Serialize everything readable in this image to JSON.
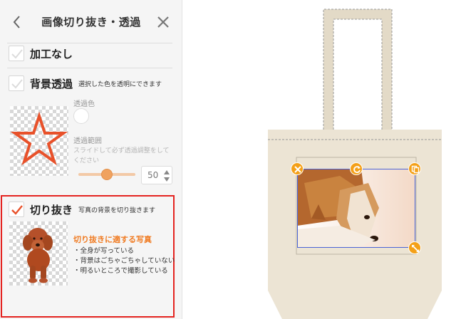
{
  "header": {
    "title": "画像切り抜き・透過",
    "back_icon": "chevron-left-icon",
    "close_icon": "close-icon"
  },
  "options": {
    "no_processing": {
      "label": "加工なし",
      "checked": false
    },
    "background_transparent": {
      "label": "背景透過",
      "description": "選択した色を透明にできます",
      "checked": false,
      "transparent_color_label": "透過色",
      "transparent_range_label": "透過範囲",
      "hint": "スライドして必ず透過調整をしてください",
      "range_value": "50",
      "range_fraction": 0.5
    },
    "cutout": {
      "label": "切り抜き",
      "description": "写真の背景を切り抜きます",
      "checked": true,
      "suitable_title": "切り抜きに適する写真",
      "bullets": [
        "・全身が写っている",
        "・背景はごちゃごちゃしていない",
        "・明るいところで撮影している"
      ]
    }
  },
  "canvas": {
    "product": "tote-bag",
    "handles": [
      "delete-icon",
      "rotate-icon",
      "duplicate-icon",
      "resize-icon"
    ]
  },
  "colors": {
    "accent": "#e8512a",
    "highlight_border": "#e42320",
    "handle": "#f4a018",
    "selection": "#4a63d6",
    "bag": "#ece4d4",
    "suitable_title": "#f07b22"
  }
}
